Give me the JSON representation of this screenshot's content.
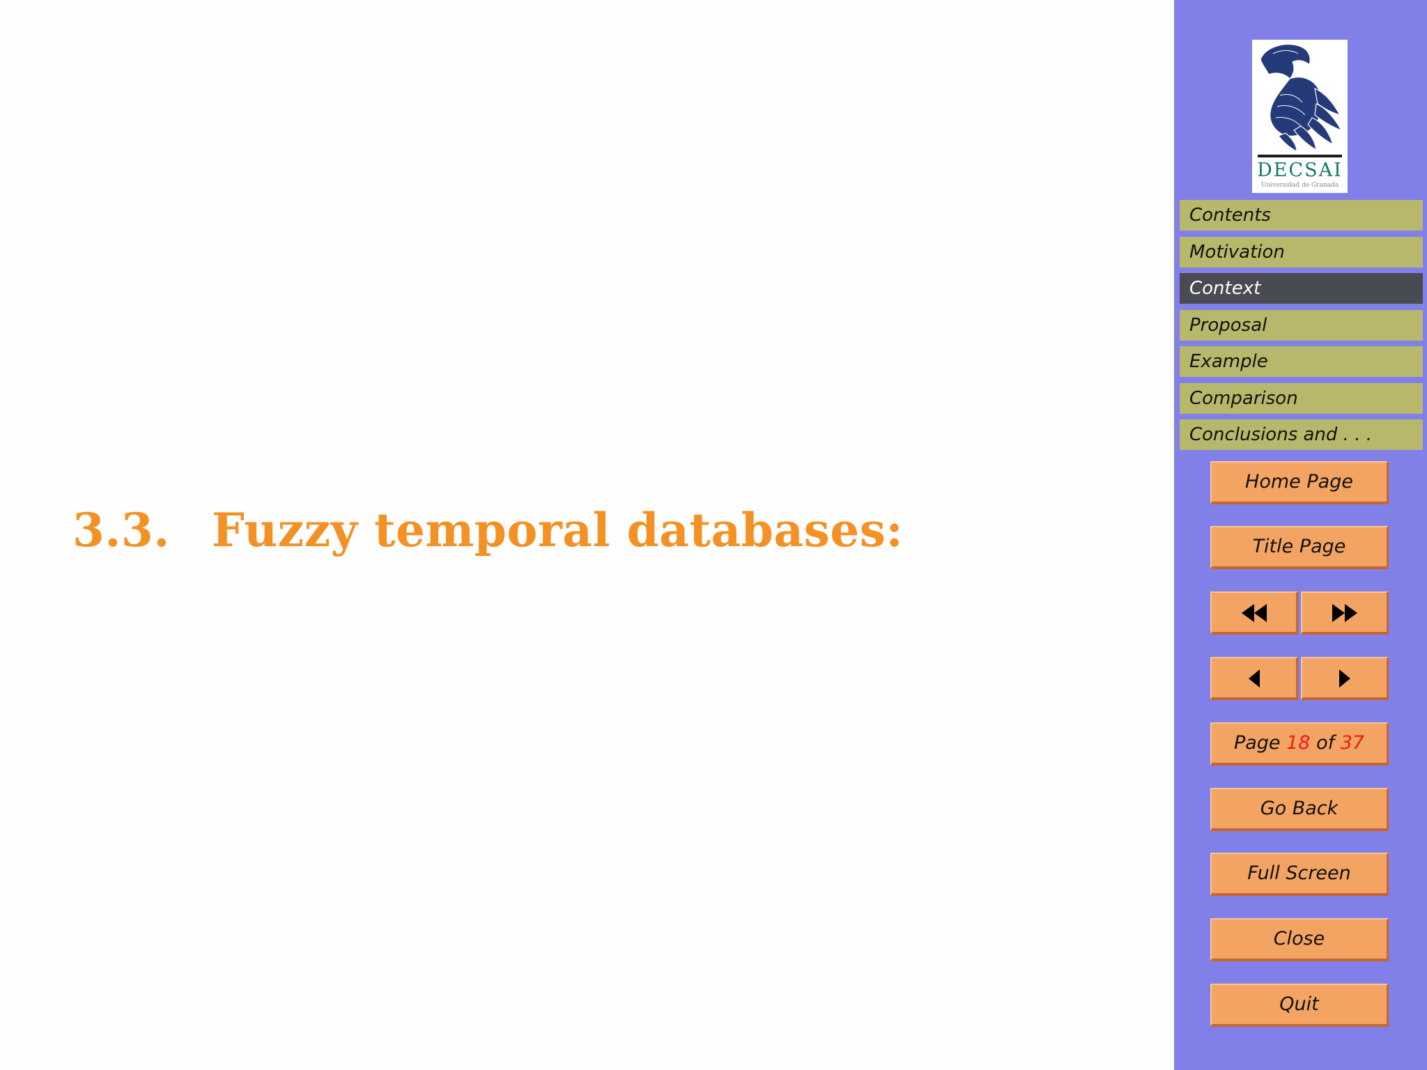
{
  "section": {
    "number": "3.3.",
    "title": "Fuzzy temporal databases:"
  },
  "logo": {
    "title": "DECSAI",
    "subtitle": "Universidad de Granada",
    "icon": "bird-emblem-icon"
  },
  "nav": {
    "items": [
      {
        "label": "Contents",
        "active": false
      },
      {
        "label": "Motivation",
        "active": false
      },
      {
        "label": "Context",
        "active": true
      },
      {
        "label": "Proposal",
        "active": false
      },
      {
        "label": "Example",
        "active": false
      },
      {
        "label": "Comparison",
        "active": false
      },
      {
        "label": "Conclusions and . . .",
        "active": false
      }
    ]
  },
  "buttons": {
    "home": "Home Page",
    "title": "Title Page",
    "first_icon": "double-left-arrow-icon",
    "last_icon": "double-right-arrow-icon",
    "prev_icon": "left-arrow-icon",
    "next_icon": "right-arrow-icon",
    "page_prefix": "Page",
    "page_current": "18",
    "page_of": "of",
    "page_total": "37",
    "go_back": "Go Back",
    "full_screen": "Full Screen",
    "close": "Close",
    "quit": "Quit"
  },
  "colors": {
    "heading": "#f39124",
    "sidebar": "#8080e8",
    "nav_item": "#b8b86c",
    "nav_active": "#4a4a52",
    "button": "#f4a462",
    "page_number": "#ee1c1c",
    "logo_text": "#157a5c",
    "logo_bird": "#253a78"
  }
}
